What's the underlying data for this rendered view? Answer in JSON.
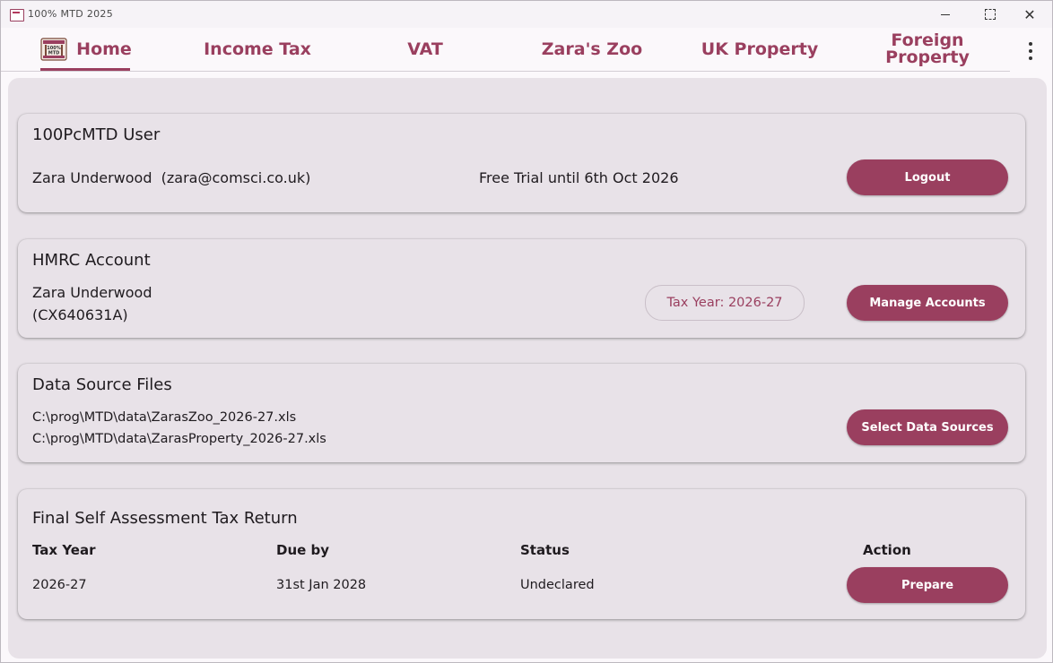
{
  "window": {
    "title": "100% MTD 2025",
    "minimize_icon": "minimize-icon",
    "maximize_icon": "maximize-icon",
    "close_label": "✕"
  },
  "nav": {
    "logo_icon": "app-logo-icon",
    "tabs": [
      {
        "label": "Home",
        "active": true
      },
      {
        "label": "Income Tax"
      },
      {
        "label": "VAT"
      },
      {
        "label": "Zara's Zoo"
      },
      {
        "label": "UK Property"
      },
      {
        "label": "Foreign Property"
      }
    ],
    "more_icon": "more-vert-icon"
  },
  "user_card": {
    "title": "100PcMTD User",
    "user": "Zara Underwood  (zara@comsci.co.uk)",
    "trial": "Free Trial until 6th Oct 2026",
    "logout_label": "Logout"
  },
  "hmrc_card": {
    "title": "HMRC Account",
    "name": "Zara Underwood",
    "nino": "(CX640631A)",
    "tax_year_chip": "Tax Year: 2026-27",
    "manage_label": "Manage Accounts"
  },
  "data_card": {
    "title": "Data Source Files",
    "files": [
      "C:\\prog\\MTD\\data\\ZarasZoo_2026-27.xls",
      "C:\\prog\\MTD\\data\\ZarasProperty_2026-27.xls"
    ],
    "select_label": "Select Data Sources"
  },
  "final_card": {
    "title": "Final Self Assessment Tax Return",
    "headers": [
      "Tax Year",
      "Due by",
      "Status",
      "Action"
    ],
    "row": {
      "tax_year": "2026-27",
      "due_by": "31st Jan 2028",
      "status": "Undeclared",
      "action_label": "Prepare"
    }
  },
  "colors": {
    "accent": "#9a3f5f",
    "card_bg": "#e8e2e8"
  }
}
